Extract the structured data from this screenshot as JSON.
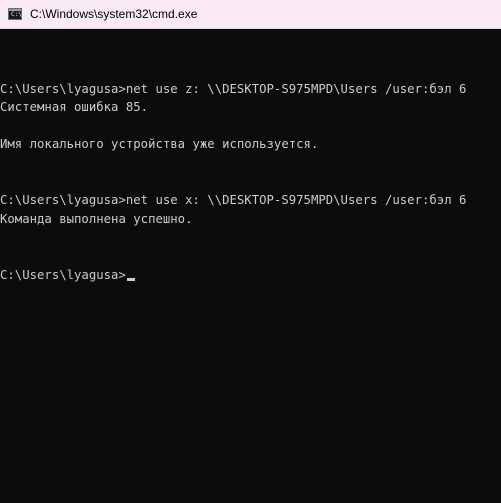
{
  "window": {
    "title": "C:\\Windows\\system32\\cmd.exe",
    "icon": "cmd-console-icon",
    "icon_glyph": "C:\\"
  },
  "console": {
    "lines": [
      "",
      "C:\\Users\\lyagusa>net use z: \\\\DESKTOP-S975MPD\\Users /user:бэл 6",
      "Системная ошибка 85.",
      "",
      "Имя локального устройства уже используется.",
      "",
      "",
      "C:\\Users\\lyagusa>net use x: \\\\DESKTOP-S975MPD\\Users /user:бэл 6",
      "Команда выполнена успешно.",
      "",
      "",
      "C:\\Users\\lyagusa>"
    ]
  },
  "colors": {
    "titlebar_bg": "#faeaf6",
    "console_bg": "#0c0c0c",
    "console_text": "#cccccc"
  }
}
